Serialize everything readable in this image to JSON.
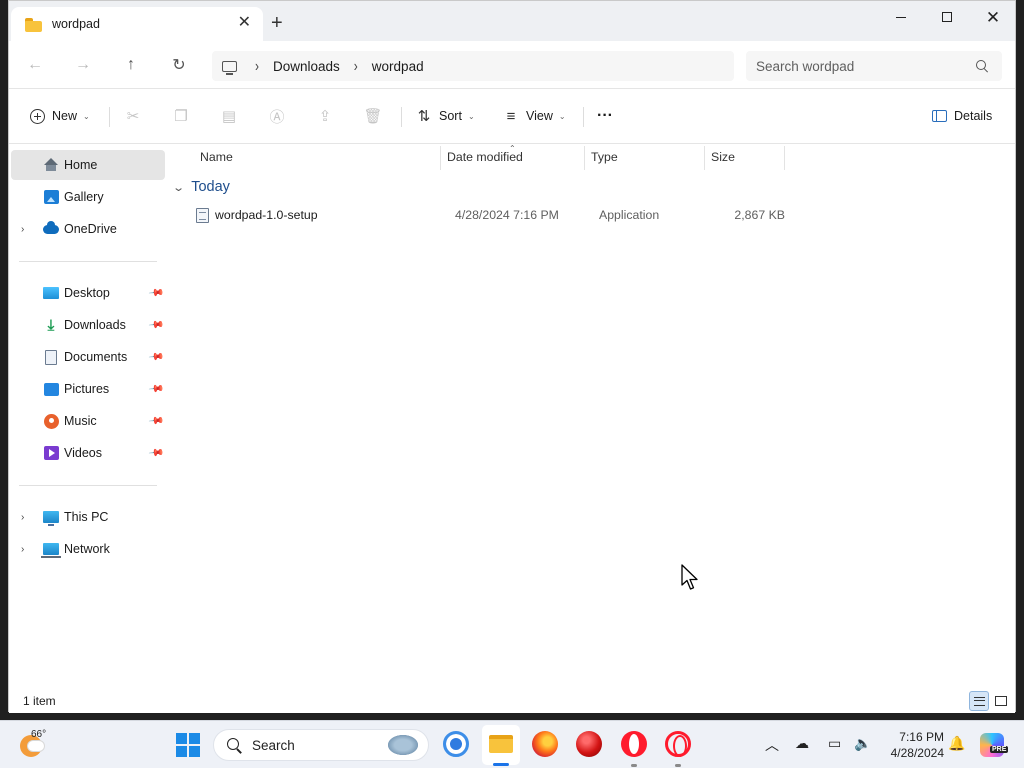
{
  "window": {
    "tab_title": "wordpad",
    "new_tab_symbol": "+",
    "tab_close_symbol": "✕",
    "close_symbol": "✕"
  },
  "nav": {
    "back_symbol": "←",
    "forward_symbol": "→",
    "up_symbol": "↑",
    "refresh_symbol": "↻",
    "breadcrumb": [
      "Downloads",
      "wordpad"
    ],
    "separator": "›",
    "search_placeholder": "Search wordpad"
  },
  "toolbar": {
    "new_label": "New",
    "sort_label": "Sort",
    "view_label": "View",
    "more_symbol": "···",
    "details_label": "Details",
    "caret": "⌄",
    "cut_symbol": "✂",
    "copy_symbol": "❐",
    "paste_symbol": "▤",
    "rename_symbol": "Ⓐ",
    "share_symbol": "⇪",
    "delete_symbol": "🗑",
    "sort_symbol": "⇅",
    "view_symbol": "≡"
  },
  "sidebar": {
    "items": [
      {
        "label": "Home",
        "icon": "home-icon",
        "selected": true
      },
      {
        "label": "Gallery",
        "icon": "gallery-icon"
      },
      {
        "label": "OneDrive",
        "icon": "onedrive-icon",
        "expandable": true
      },
      {
        "label": "Desktop",
        "icon": "desktop-icon",
        "pinned": true
      },
      {
        "label": "Downloads",
        "icon": "downloads-icon",
        "pinned": true
      },
      {
        "label": "Documents",
        "icon": "documents-icon",
        "pinned": true
      },
      {
        "label": "Pictures",
        "icon": "pictures-icon",
        "pinned": true
      },
      {
        "label": "Music",
        "icon": "music-icon",
        "pinned": true
      },
      {
        "label": "Videos",
        "icon": "videos-icon",
        "pinned": true
      },
      {
        "label": "This PC",
        "icon": "this-pc-icon",
        "expandable": true
      },
      {
        "label": "Network",
        "icon": "network-icon",
        "expandable": true
      }
    ],
    "chevron": "›",
    "pin_symbol": "📌"
  },
  "filelist": {
    "columns": [
      "Name",
      "Date modified",
      "Type",
      "Size"
    ],
    "sort_indicator": "⌃",
    "group_label": "Today",
    "group_chevron": "⌄",
    "files": [
      {
        "name": "wordpad-1.0-setup",
        "date": "4/28/2024 7:16 PM",
        "type": "Application",
        "size": "2,867 KB"
      }
    ]
  },
  "status": {
    "item_count": "1 item"
  },
  "taskbar": {
    "temperature": "66°",
    "search_label": "Search",
    "time": "7:16 PM",
    "date": "4/28/2024",
    "chevron_up": "︿",
    "pre_badge": "PRE",
    "tray_onedrive": "☁",
    "tray_display": "▭",
    "tray_sound": "🔈",
    "tray_bell": "🔔"
  },
  "colors": {
    "accent": "#1a73e8",
    "selected_bg": "#e5e5e5",
    "group_header": "#1f4e8c"
  }
}
